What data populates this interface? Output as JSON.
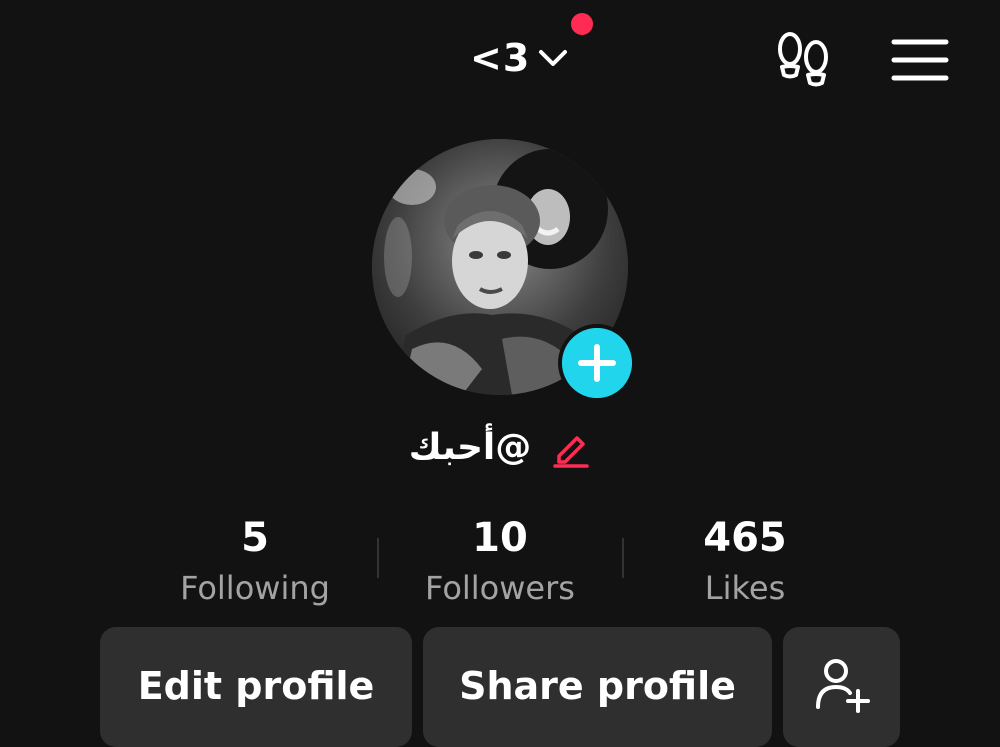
{
  "header": {
    "account_name": "<3",
    "colors": {
      "notification_dot": "#fe2c55",
      "background": "#121212"
    },
    "icons": [
      "chevron-down-icon",
      "footprints-icon",
      "hamburger-menu-icon"
    ]
  },
  "profile": {
    "username": "@أحبك",
    "avatar_alt": "profile photo",
    "add_button_color": "#20d5ec",
    "edit_icon_color": "#fe2c55"
  },
  "stats": {
    "following": {
      "value": "5",
      "label": "Following"
    },
    "followers": {
      "value": "10",
      "label": "Followers"
    },
    "likes": {
      "value": "465",
      "label": "Likes"
    }
  },
  "actions": {
    "edit_profile": "Edit profile",
    "share_profile": "Share profile",
    "add_friend_icon": "add-friend-icon"
  }
}
